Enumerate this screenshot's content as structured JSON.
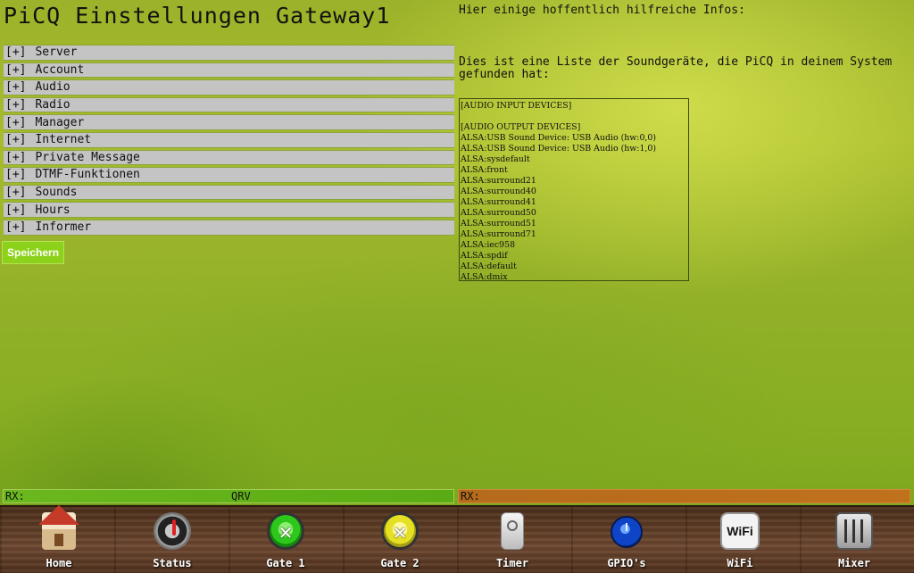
{
  "page_title": "PiCQ Einstellungen Gateway1",
  "settings_sections": [
    {
      "toggle": "[+]",
      "label": "Server"
    },
    {
      "toggle": "[+]",
      "label": "Account"
    },
    {
      "toggle": "[+]",
      "label": "Audio"
    },
    {
      "toggle": "[+]",
      "label": "Radio"
    },
    {
      "toggle": "[+]",
      "label": "Manager"
    },
    {
      "toggle": "[+]",
      "label": "Internet"
    },
    {
      "toggle": "[+]",
      "label": "Private Message"
    },
    {
      "toggle": "[+]",
      "label": "DTMF-Funktionen"
    },
    {
      "toggle": "[+]",
      "label": "Sounds"
    },
    {
      "toggle": "[+]",
      "label": "Hours"
    },
    {
      "toggle": "[+]",
      "label": "Informer"
    }
  ],
  "save_label": "Speichern",
  "info": {
    "heading": "Hier einige hoffentlich hilfreiche Infos:",
    "text": "Dies ist eine Liste der Soundgeräte, die PiCQ in deinem System gefunden hat:",
    "devices": [
      "[AUDIO INPUT DEVICES]",
      "",
      "[AUDIO OUTPUT DEVICES]",
      "ALSA:USB Sound Device: USB Audio (hw:0,0)",
      "ALSA:USB Sound Device: USB Audio (hw:1,0)",
      "ALSA:sysdefault",
      "ALSA:front",
      "ALSA:surround21",
      "ALSA:surround40",
      "ALSA:surround41",
      "ALSA:surround50",
      "ALSA:surround51",
      "ALSA:surround71",
      "ALSA:iec958",
      "ALSA:spdif",
      "ALSA:default",
      "ALSA:dmix"
    ]
  },
  "rx_left": {
    "label": "RX:",
    "status": "QRV",
    "color": "#5fb01a"
  },
  "rx_right": {
    "label": "RX:",
    "status": "",
    "color": "#bb6e1c"
  },
  "dock": [
    {
      "label": "Home",
      "icon": "home-icon"
    },
    {
      "label": "Status",
      "icon": "status-icon"
    },
    {
      "label": "Gate 1",
      "icon": "gate1-icon"
    },
    {
      "label": "Gate 2",
      "icon": "gate2-icon"
    },
    {
      "label": "Timer",
      "icon": "timer-icon"
    },
    {
      "label": "GPIO's",
      "icon": "gpio-icon"
    },
    {
      "label": "WiFi",
      "icon": "wifi-icon"
    },
    {
      "label": "Mixer",
      "icon": "mixer-icon"
    }
  ]
}
